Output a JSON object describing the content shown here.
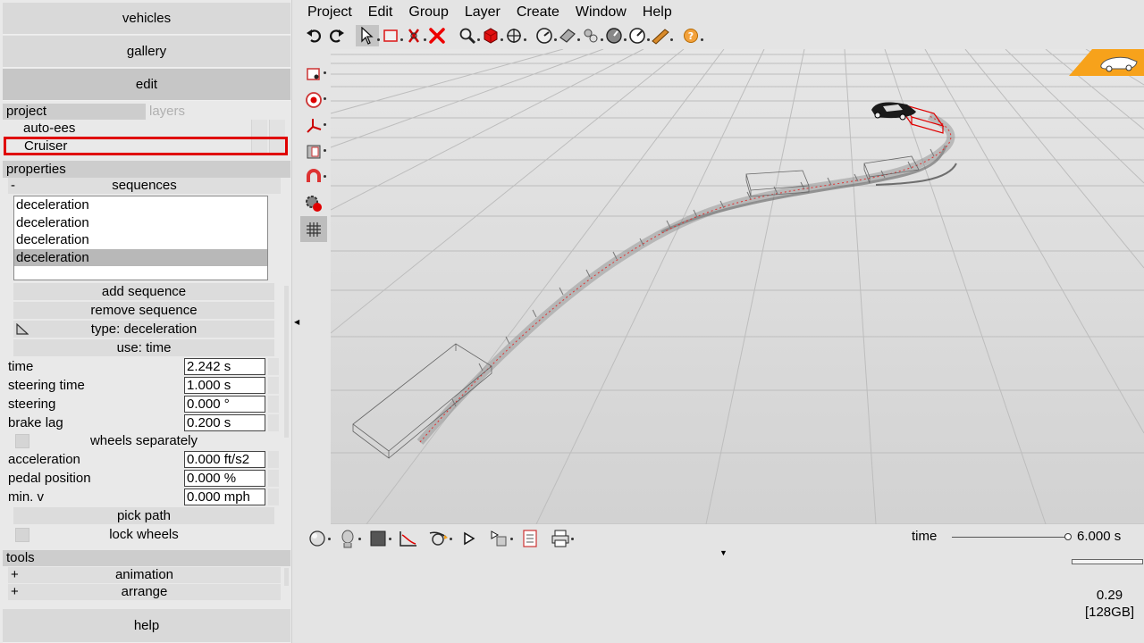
{
  "left_panel": {
    "vehicles_label": "vehicles",
    "gallery_label": "gallery",
    "edit_label": "edit",
    "project_tab": "project",
    "layers_tab": "layers",
    "project_items": [
      "auto-ees",
      "Cruiser"
    ],
    "properties_header": "properties",
    "sequences": {
      "sign": "-",
      "header": "sequences",
      "items": [
        "deceleration",
        "deceleration",
        "deceleration",
        "deceleration"
      ],
      "selected_index": 3
    },
    "add_sequence_label": "add sequence",
    "remove_sequence_label": "remove sequence",
    "type_label": "type: deceleration",
    "use_label": "use: time",
    "properties": [
      {
        "label": "time",
        "value": "2.242 s"
      },
      {
        "label": "steering time",
        "value": "1.000 s"
      },
      {
        "label": "steering",
        "value": "0.000 °"
      },
      {
        "label": "brake lag",
        "value": "0.200 s"
      }
    ],
    "wheels_separately_label": "wheels separately",
    "properties2": [
      {
        "label": "acceleration",
        "value": "0.000 ft/s2"
      },
      {
        "label": "pedal position",
        "value": "0.000 %"
      },
      {
        "label": "min. v",
        "value": "0.000 mph"
      }
    ],
    "pick_path_label": "pick path",
    "lock_wheels_label": "lock wheels",
    "tools_header": "tools",
    "tools": [
      {
        "sign": "+",
        "label": "animation"
      },
      {
        "sign": "+",
        "label": "arrange"
      }
    ],
    "help_label": "help"
  },
  "menu": [
    "Project",
    "Edit",
    "Group",
    "Layer",
    "Create",
    "Window",
    "Help"
  ],
  "toolbar_icons": [
    "undo-icon",
    "redo-icon",
    "select-arrow-icon",
    "rectangle-select-icon",
    "cut-icon",
    "delete-icon",
    "zoom-icon",
    "cube-icon",
    "move-icon",
    "gauge-icon",
    "tape-icon",
    "roll-icon",
    "dial-icon",
    "dial2-icon",
    "pencil-icon",
    "help-icon"
  ],
  "bottom": {
    "time_label": "time",
    "time_value": "6.000 s",
    "time_fraction": 1.0,
    "status_line1": "0.29",
    "status_line2": "[128GB]"
  },
  "colors": {
    "accent_orange": "#f7a21b",
    "selection_red": "#e00000",
    "path_red": "#e03030"
  }
}
